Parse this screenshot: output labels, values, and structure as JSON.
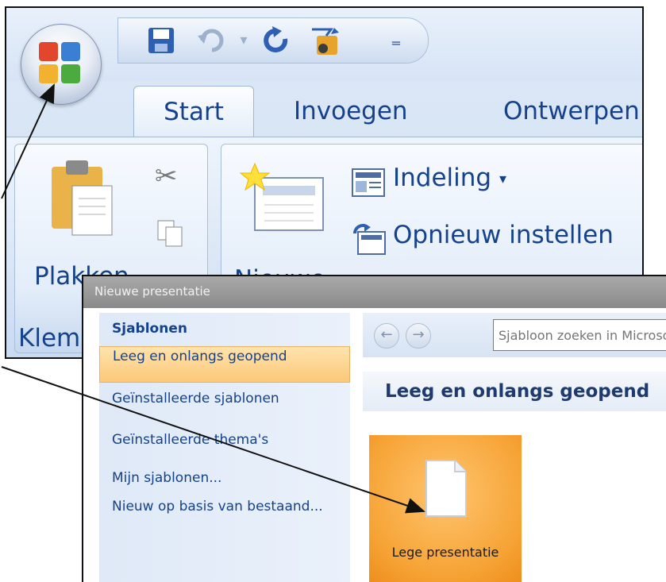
{
  "app": {
    "tabs": [
      "Start",
      "Invoegen",
      "Ontwerpen"
    ],
    "active_tab": "Start"
  },
  "ribbon": {
    "clipboard": {
      "paste_label": "Plakken",
      "group_label": "Klem"
    },
    "slides": {
      "new_slide_label": "Nieuwe",
      "layout_label": "Indeling",
      "reset_label": "Opnieuw instellen"
    }
  },
  "dialog": {
    "title": "Nieuwe presentatie",
    "nav": {
      "header": "Sjablonen",
      "items": [
        "Leeg en onlangs geopend",
        "Geïnstalleerde sjablonen",
        "Geïnstalleerde thema's",
        "Mijn sjablonen...",
        "Nieuw op basis van bestaand..."
      ],
      "selected": "Leeg en onlangs geopend"
    },
    "search": {
      "placeholder": "Sjabloon zoeken in Microsoft Office Online"
    },
    "section_title": "Leeg en onlangs geopend",
    "tile_label": "Lege presentatie"
  },
  "colors": {
    "accent_orange": "#f6a335",
    "ribbon_text": "#15428b",
    "selected_nav": "#fbc878"
  }
}
